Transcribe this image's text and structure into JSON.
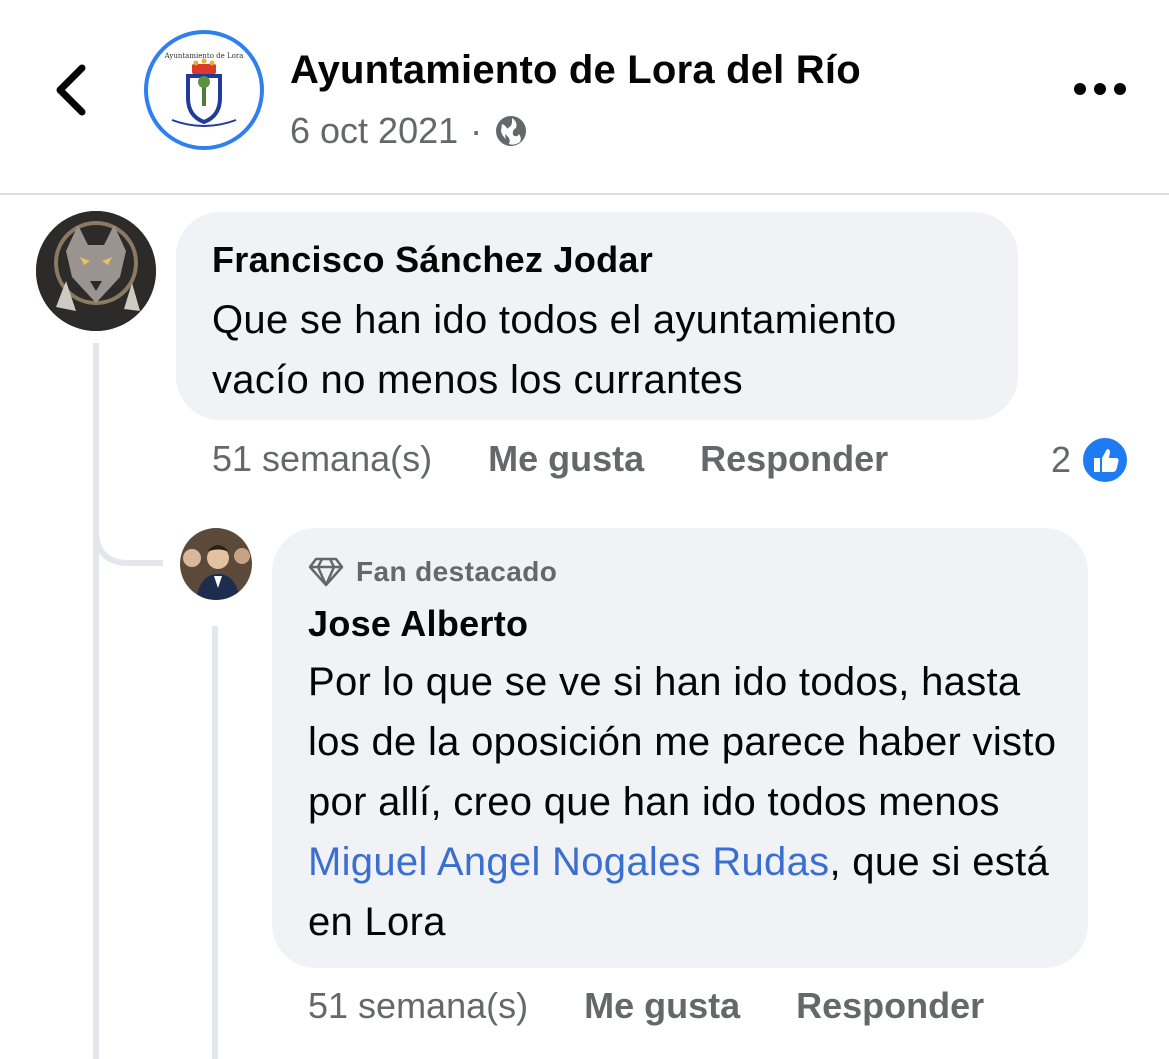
{
  "header": {
    "page_name": "Ayuntamiento de Lora del Río",
    "date": "6 oct 2021",
    "separator": "·",
    "avatar_text": "Ayuntamiento de Lora"
  },
  "comments": [
    {
      "author": "Francisco Sánchez Jodar",
      "text": "Que se han ido todos el ayuntamiento vacío no menos los currantes",
      "time": "51 semana(s)",
      "like_label": "Me gusta",
      "reply_label": "Responder",
      "reaction_count": "2"
    }
  ],
  "reply": {
    "badge": "Fan destacado",
    "author": "Jose Alberto",
    "text_before": "Por lo que se ve si han ido todos, hasta los de la oposición me parece haber visto por allí, creo que han ido todos menos ",
    "mention": "Miguel Angel Nogales Rudas",
    "text_after": ", que si está en Lora",
    "time": "51 semana(s)",
    "like_label": "Me gusta",
    "reply_label": "Responder"
  },
  "colors": {
    "accent": "#2f7ff0",
    "bubble": "#f0f2f5",
    "secondary_text": "#65676b",
    "mention": "#3a6fd1"
  },
  "icons": [
    "back-arrow-icon",
    "globe-icon",
    "more-options-icon",
    "like-reaction-icon",
    "diamond-icon"
  ]
}
